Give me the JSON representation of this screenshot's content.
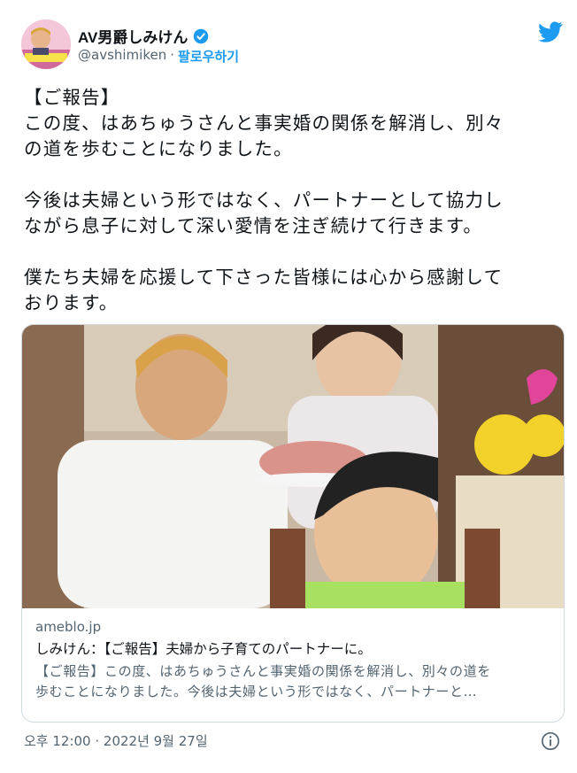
{
  "user": {
    "display_name": "AV男爵しみけん",
    "handle": "@avshimiken",
    "separator": "·",
    "follow_label": "팔로우하기"
  },
  "tweet": {
    "text": "【ご報告】\nこの度、はあちゅうさんと事実婚の関係を解消し、別々\nの道を歩むことになりました。\n\n今後は夫婦という形ではなく、パートナーとして協力し\nながら息子に対して深い愛情を注ぎ続けて行きます。\n\n僕たち夫婦を応援して下さった皆様には心から感謝して\nおります。"
  },
  "card": {
    "domain": "ameblo.jp",
    "title": "しみけん：【ご報告】夫婦から子育てのパートナーに。",
    "description": "【ご報告】この度、はあちゅうさんと事実婚の関係を解消し、別々の道を\n歩むことになりました。今後は夫婦という形ではなく、パートナーと…"
  },
  "timestamp": "오후 12:00 · 2022년 9월 27일",
  "colors": {
    "accent": "#1d9bf0",
    "text": "#0f1419",
    "secondary": "#536471",
    "border": "#cfd9de"
  },
  "icons": [
    "verified-badge-icon",
    "twitter-bird-icon",
    "info-icon"
  ]
}
